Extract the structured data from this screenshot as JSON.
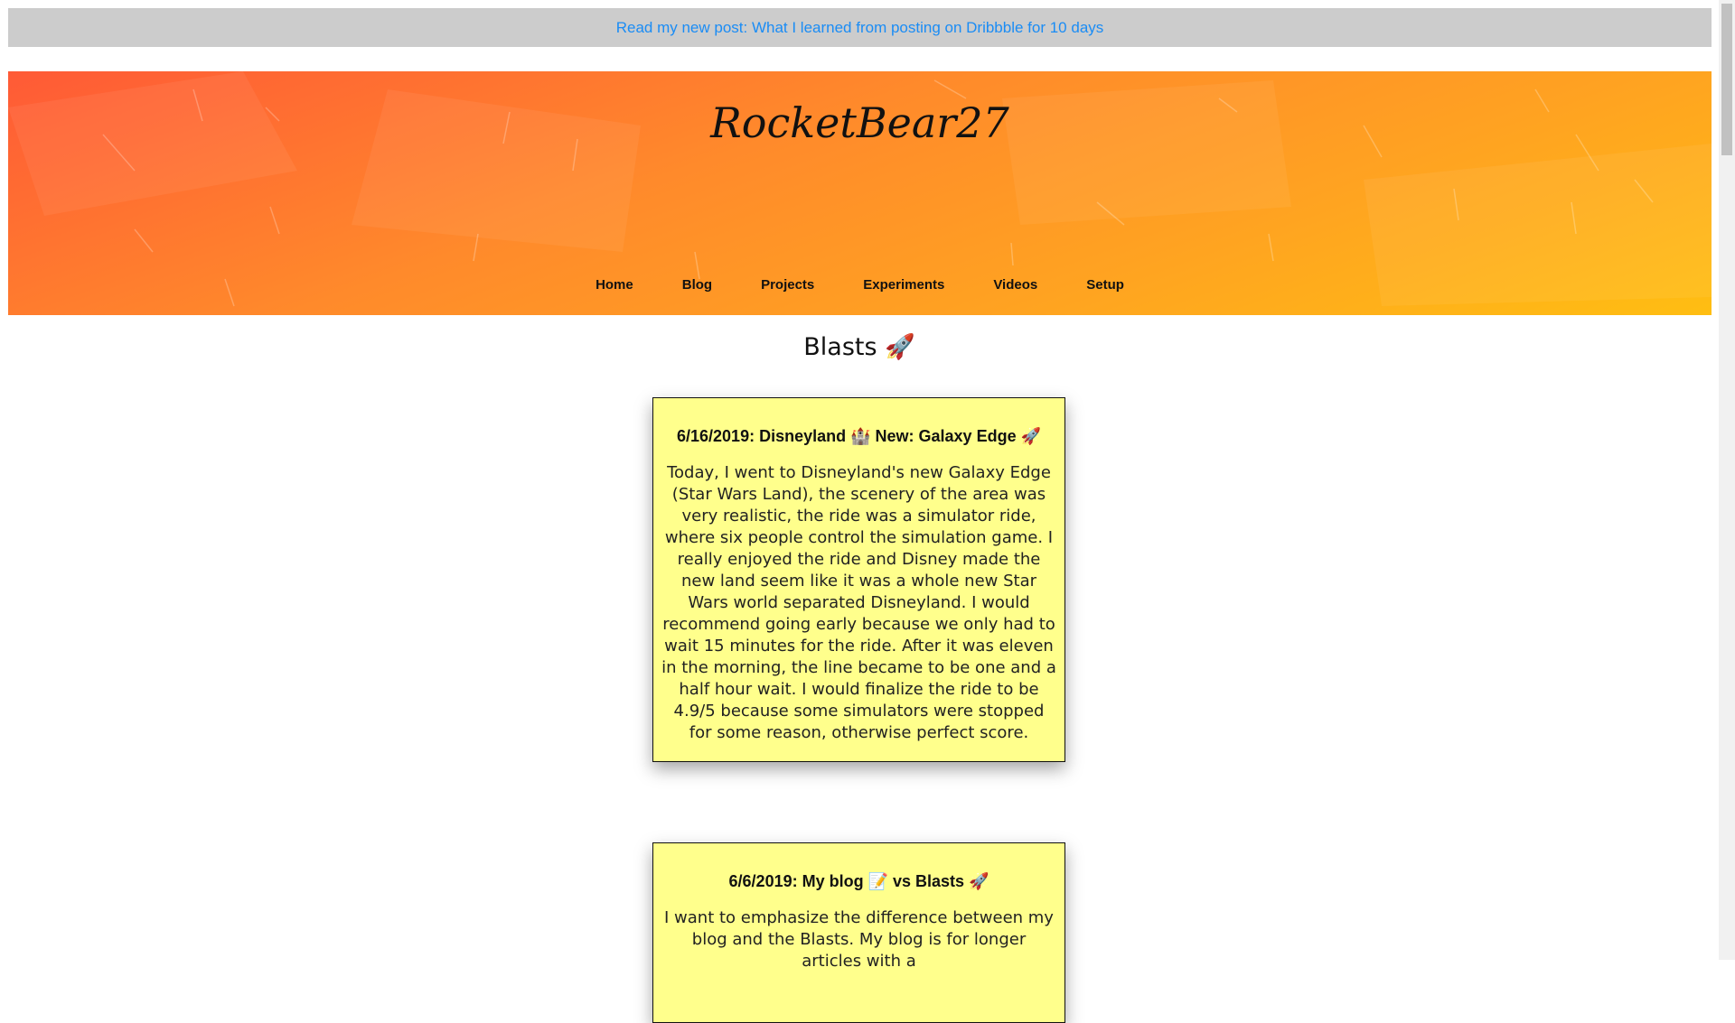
{
  "announcement": {
    "link_text": "Read my new post: What I learned from posting on Dribbble for 10 days"
  },
  "header": {
    "logo": "RocketBear27",
    "nav": [
      "Home",
      "Blog",
      "Projects",
      "Experiments",
      "Videos",
      "Setup"
    ]
  },
  "main": {
    "title": "Blasts 🚀",
    "posts": [
      {
        "title": "6/16/2019: Disneyland 🏰 New: Galaxy Edge 🚀",
        "body": "Today, I went to Disneyland's new Galaxy Edge (Star Wars Land), the scenery of the area was very realistic, the ride was a simulator ride, where six people control the simulation game. I really enjoyed the ride and Disney made the new land seem like it was a whole new Star Wars world separated Disneyland. I would recommend going early because we only had to wait 15 minutes for the ride. After it was eleven in the morning, the line became to be one and a half hour wait. I would finalize the ride to be 4.9/5 because some simulators were stopped for some reason, otherwise perfect score."
      },
      {
        "title": "6/6/2019: My blog 📝 vs Blasts 🚀",
        "body": "I want to emphasize the difference between my blog and the Blasts. My blog is for longer articles with a"
      }
    ]
  },
  "colors": {
    "announce_bg": "#cccccc",
    "link": "#1a8cf5",
    "hero_start": "#ff5a36",
    "hero_end": "#ffbe12",
    "card_bg": "#ffff8c"
  },
  "icons": {
    "rocket": "rocket-icon",
    "castle": "castle-icon",
    "memo": "memo-icon"
  }
}
